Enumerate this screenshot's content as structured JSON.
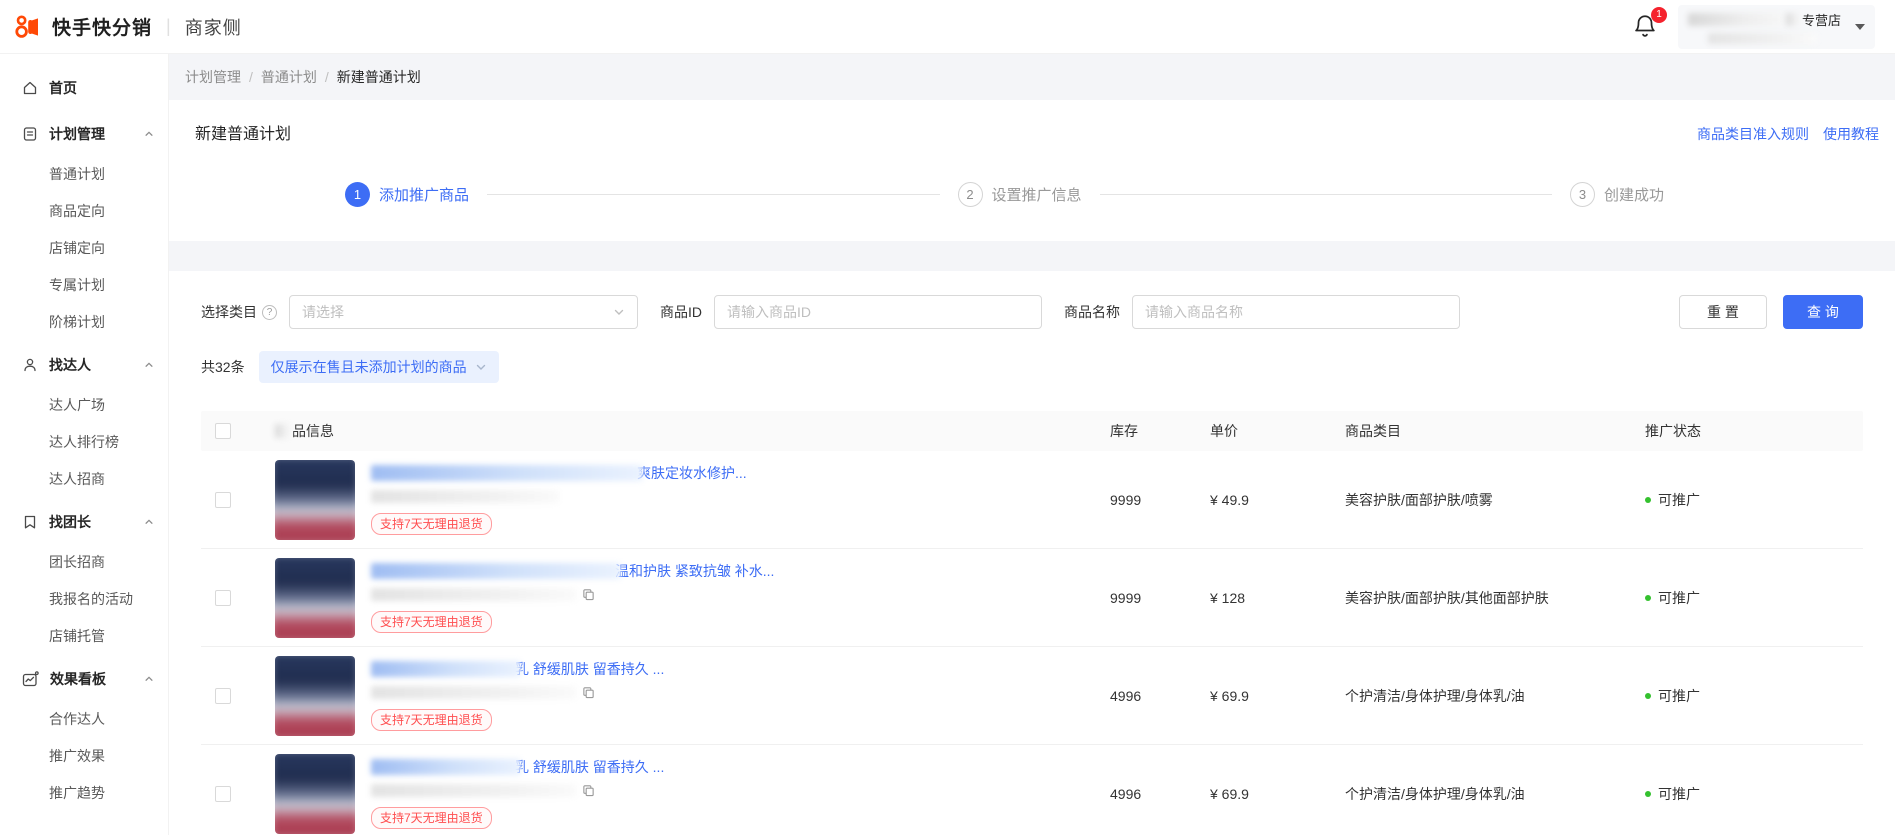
{
  "header": {
    "brand": "快手快分销",
    "side_label": "商家侧",
    "notification_count": "1",
    "account_suffix": "专营店"
  },
  "sidebar": {
    "sections": [
      {
        "label": "首页",
        "icon": "home-icon",
        "children": []
      },
      {
        "label": "计划管理",
        "icon": "plan-icon",
        "children": [
          "普通计划",
          "商品定向",
          "店铺定向",
          "专属计划",
          "阶梯计划"
        ]
      },
      {
        "label": "找达人",
        "icon": "person-icon",
        "children": [
          "达人广场",
          "达人排行榜",
          "达人招商"
        ]
      },
      {
        "label": "找团长",
        "icon": "bookmark-icon",
        "children": [
          "团长招商",
          "我报名的活动",
          "店铺托管"
        ]
      },
      {
        "label": "效果看板",
        "icon": "chart-icon",
        "children": [
          "合作达人",
          "推广效果",
          "推广趋势"
        ]
      }
    ]
  },
  "breadcrumb": [
    "计划管理",
    "普通计划",
    "新建普通计划"
  ],
  "page": {
    "title": "新建普通计划",
    "links": [
      "商品类目准入规则",
      "使用教程"
    ]
  },
  "stepper": [
    {
      "num": "1",
      "label": "添加推广商品",
      "active": true
    },
    {
      "num": "2",
      "label": "设置推广信息",
      "active": false
    },
    {
      "num": "3",
      "label": "创建成功",
      "active": false
    }
  ],
  "filters": {
    "category_label": "选择类目",
    "category_placeholder": "请选择",
    "product_id_label": "商品ID",
    "product_id_placeholder": "请输入商品ID",
    "product_name_label": "商品名称",
    "product_name_placeholder": "请输入商品名称",
    "reset_label": "重 置",
    "query_label": "查 询"
  },
  "list": {
    "total": "共32条",
    "filter_chip": "仅展示在售且未添加计划的商品"
  },
  "table": {
    "headers": {
      "product": "品信息",
      "stock": "库存",
      "price": "单价",
      "category": "商品类目",
      "status": "推广状态"
    },
    "rows": [
      {
        "title_visible": "爽肤定妆水修护...",
        "title_blur_w": 272,
        "id_blur_w": 188,
        "has_copy": false,
        "tag": "支持7天无理由退货",
        "stock": "9999",
        "price": "¥ 49.9",
        "category": "美容护肤/面部护肤/喷雾",
        "status": "可推广"
      },
      {
        "title_visible": "温和护肤 紧致抗皱 补水...",
        "title_blur_w": 250,
        "id_blur_w": 205,
        "has_copy": true,
        "tag": "支持7天无理由退货",
        "stock": "9999",
        "price": "¥ 128",
        "category": "美容护肤/面部护肤/其他面部护肤",
        "status": "可推广"
      },
      {
        "title_visible": "乳 舒缓肌肤 留香持久 ...",
        "title_blur_w": 150,
        "id_blur_w": 205,
        "has_copy": true,
        "tag": "支持7天无理由退货",
        "stock": "4996",
        "price": "¥ 69.9",
        "category": "个护清洁/身体护理/身体乳/油",
        "status": "可推广"
      },
      {
        "title_visible": "乳 舒缓肌肤 留香持久 ...",
        "title_blur_w": 150,
        "id_blur_w": 205,
        "has_copy": true,
        "tag": "支持7天无理由退货",
        "stock": "4996",
        "price": "¥ 69.9",
        "category": "个护清洁/身体护理/身体乳/油",
        "status": "可推广"
      }
    ]
  },
  "colors": {
    "accent_blue": "#3d6df5",
    "brand_orange": "#ff4906",
    "status_green": "#34c12e",
    "tag_red": "#ff4d4f",
    "badge_red": "#f5222d"
  }
}
